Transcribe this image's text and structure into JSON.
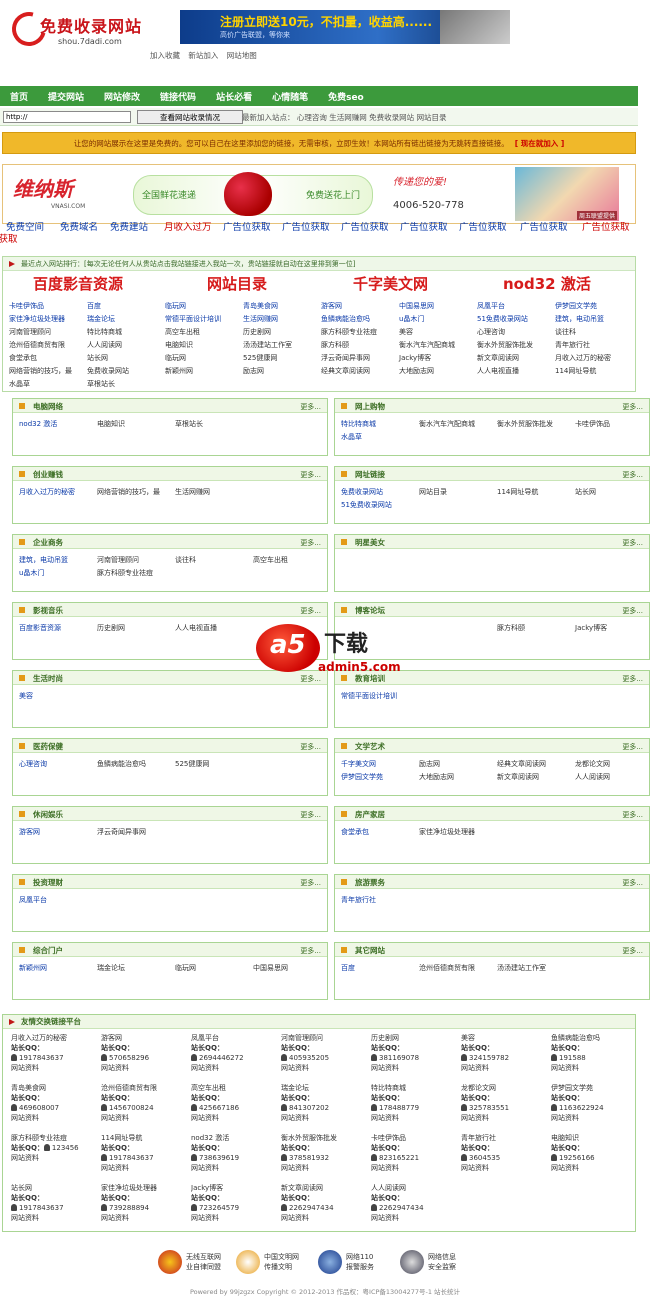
{
  "header": {
    "logo_name": "免费收录网站",
    "logo_domain": "shou.7dadi.com",
    "banner_title": "注册立即送10元，不扣量，收益高......",
    "banner_sub": "高价广告联盟，等你来",
    "quicklinks": [
      "加入收藏",
      "新站加入",
      "网站地图"
    ]
  },
  "nav": [
    "首页",
    "提交网站",
    "网站修改",
    "链接代码",
    "站长必看",
    "心情随笔",
    "免费seo"
  ],
  "search": {
    "value": "http://",
    "button": "查看网站收录情况",
    "recent_label": "最新加入站点：",
    "recent": [
      "心理咨询",
      "生活网赚网",
      "免费收录网站",
      "网站目录"
    ]
  },
  "notice": {
    "text": "让您的网站展示在这里是免费的。您可以自己在这里添加您的链接，无需审核，立即生效！本网站所有链出链接为无跳转直接链接。",
    "join": "[ 现在就加入 ]"
  },
  "ad": {
    "logo": "维纳斯",
    "logo_sub": "VNASI.COM",
    "mid_left": "全国鲜花速递",
    "mid_right": "免费送花上门",
    "slogan": "传递您的爱!",
    "phone": "4006-520-778",
    "corner": "周五联盟提供"
  },
  "ad_links": [
    "免费空间",
    "免费域名",
    "免费建站",
    "月收入过万",
    "广告位获取",
    "广告位获取",
    "广告位获取",
    "广告位获取",
    "广告位获取",
    "广告位获取",
    "广告位获取",
    "广告位获取"
  ],
  "ranking": {
    "header": "最近点入网站排行：[每次无论任何人从贵站点击我站链接进入我站一次，贵站链接就自动在这里排到第一位]",
    "big": [
      "百度影音资源",
      "网站目录",
      "千字美文网",
      "nod32 激活"
    ],
    "items": [
      [
        "卡哇伊饰品",
        "百度",
        "临玩网",
        "青岛美食网",
        "游客网",
        "中国易思网",
        "凤凰平台",
        "伊梦园文学苑"
      ],
      [
        "家佳净垃圾处理器",
        "瑞金论坛",
        "常德平面设计培训",
        "生活网赚网",
        "鱼鳞病能治愈吗",
        "u晶木门",
        "51免费收录网站",
        "建筑，电动吊篮"
      ],
      [
        "河南管理顾问",
        "特比特商城",
        "高空车出租",
        "历史剧网",
        "豚方科颐专业祛痘",
        "美容",
        "心理咨询",
        "谈往科"
      ],
      [
        "沧州佰德商贸有限",
        "人人阅读网",
        "电脑知识",
        "汤汤建站工作室",
        "豚方科颐",
        "衡水汽车汽配商城",
        "衡水外贸服饰批发",
        "青年旅行社"
      ],
      [
        "食堂承包",
        "站长网",
        "临玩网",
        "525健康网",
        "浮云奇闻异事网",
        "Jacky博客",
        "新文章阅读网",
        "月收入过万的秘密"
      ],
      [
        "网络营销的技巧，最",
        "免费收录网站",
        "新颖州网",
        "励志网",
        "经典文章阅读网",
        "大地励志网",
        "人人电视直播",
        "114网址导航"
      ],
      [
        "水晶草",
        "草根站长",
        "",
        "",
        "",
        "",
        "",
        ""
      ]
    ]
  },
  "categories": [
    {
      "title": "电脑网络",
      "more": "更多...",
      "rows": [
        [
          "nod32 激活",
          "电脑知识",
          "草根站长"
        ]
      ]
    },
    {
      "title": "网上购物",
      "more": "更多...",
      "rows": [
        [
          "特比特商城",
          "衡水汽车汽配商城",
          "衡水外贸服饰批发",
          "卡哇伊饰品"
        ],
        [
          "水晶草"
        ]
      ]
    },
    {
      "title": "创业赚钱",
      "more": "更多...",
      "rows": [
        [
          "月收入过万的秘密",
          "网络营销的技巧，最",
          "生活网赚网"
        ]
      ]
    },
    {
      "title": "网址链接",
      "more": "更多...",
      "rows": [
        [
          "免费收录网站",
          "网站目录",
          "114网址导航",
          "站长网"
        ],
        [
          "51免费收录网站"
        ]
      ]
    },
    {
      "title": "企业商务",
      "more": "更多...",
      "rows": [
        [
          "建筑，电动吊篮",
          "河南管理顾问",
          "谈往科",
          "高空车出租"
        ],
        [
          "u晶木门",
          "豚方科颐专业祛痘"
        ]
      ]
    },
    {
      "title": "明星美女",
      "more": "更多...",
      "rows": []
    },
    {
      "title": "影视音乐",
      "more": "更多...",
      "rows": [
        [
          "百度影音资源",
          "历史剧网",
          "人人电视直播"
        ]
      ]
    },
    {
      "title": "博客论坛",
      "more": "更多...",
      "rows": [
        [
          "",
          "",
          "豚方科颐",
          "Jacky博客"
        ]
      ]
    },
    {
      "title": "生活时尚",
      "more": "更多...",
      "rows": [
        [
          "美容"
        ]
      ]
    },
    {
      "title": "教育培训",
      "more": "更多...",
      "rows": [
        [
          "常德平面设计培训"
        ]
      ]
    },
    {
      "title": "医药保健",
      "more": "更多...",
      "rows": [
        [
          "心理咨询",
          "鱼鳞病能治愈吗",
          "525健康网"
        ]
      ]
    },
    {
      "title": "文学艺术",
      "more": "更多...",
      "rows": [
        [
          "千字美文网",
          "励志网",
          "经典文章阅读网",
          "龙都论文网"
        ],
        [
          "伊梦园文学苑",
          "大地励志网",
          "新文章阅读网",
          "人人阅读网"
        ]
      ]
    },
    {
      "title": "休闲娱乐",
      "more": "更多...",
      "rows": [
        [
          "游客网",
          "浮云奇闻异事网"
        ]
      ]
    },
    {
      "title": "房产家居",
      "more": "更多...",
      "rows": [
        [
          "食堂承包",
          "家佳净垃圾处理器"
        ]
      ]
    },
    {
      "title": "投资理财",
      "more": "更多...",
      "rows": [
        [
          "凤凰平台"
        ]
      ]
    },
    {
      "title": "旅游票务",
      "more": "更多...",
      "rows": [
        [
          "青年旅行社"
        ]
      ]
    },
    {
      "title": "综合门户",
      "more": "更多...",
      "rows": [
        [
          "新颖州网",
          "瑞金论坛",
          "临玩网",
          "中国易思网"
        ]
      ]
    },
    {
      "title": "其它网站",
      "more": "更多...",
      "rows": [
        [
          "百度",
          "沧州佰德商贸有限",
          "汤汤建站工作室"
        ]
      ]
    }
  ],
  "friends": {
    "title": "友情交换链接平台",
    "qq_label": "站长QQ：",
    "info_label": "网站资料",
    "items": [
      {
        "name": "月收入过万的秘密",
        "qq": "1917843637"
      },
      {
        "name": "游客网",
        "qq": "570658296"
      },
      {
        "name": "凤凰平台",
        "qq": "2694446272"
      },
      {
        "name": "河南管理顾问",
        "qq": "405935205"
      },
      {
        "name": "历史剧网",
        "qq": "381169078"
      },
      {
        "name": "美容",
        "qq": "324159782"
      },
      {
        "name": "鱼鳞病能治愈吗",
        "qq": "191588"
      },
      {
        "name": "青岛美食网",
        "qq": "469608007"
      },
      {
        "name": "沧州佰德商贸有限",
        "qq": "1456700824"
      },
      {
        "name": "高空车出租",
        "qq": "425667186"
      },
      {
        "name": "瑞金论坛",
        "qq": "841307202"
      },
      {
        "name": "特比特商城",
        "qq": "178488779"
      },
      {
        "name": "龙都论文网",
        "qq": "325783551"
      },
      {
        "name": "伊梦园文学苑",
        "qq": "1163622924"
      },
      {
        "name": "豚方科颐专业祛痘",
        "qq": "123456"
      },
      {
        "name": "114网址导航",
        "qq": "1917843637"
      },
      {
        "name": "nod32 激活",
        "qq": "738639619"
      },
      {
        "name": "衡水外贸服饰批发",
        "qq": "378581932"
      },
      {
        "name": "卡哇伊饰品",
        "qq": "823165221"
      },
      {
        "name": "青年旅行社",
        "qq": "3604535"
      },
      {
        "name": "电脑知识",
        "qq": "19256166"
      },
      {
        "name": "站长网",
        "qq": "1917843637"
      },
      {
        "name": "家佳净垃圾处理器",
        "qq": "739288894"
      },
      {
        "name": "Jacky博客",
        "qq": "723264579"
      },
      {
        "name": "新文章阅读网",
        "qq": "2262947434"
      },
      {
        "name": "人人阅读网",
        "qq": "2262947434"
      }
    ]
  },
  "watermark": {
    "a5": "a5",
    "xz": "下载",
    "domain": "admin5.com"
  },
  "footer": {
    "badges": [
      {
        "l1": "无线互联网",
        "l2": "业自律同盟"
      },
      {
        "l1": "中国文明网",
        "l2": "传播文明"
      },
      {
        "l1": "网络110",
        "l2": "报警服务"
      },
      {
        "l1": "网络信息",
        "l2": "安全监察"
      }
    ],
    "copyright": "Powered by 99jzgzx Copyright © 2012-2013 作品权：粤ICP备13004277号-1 站长统计"
  }
}
